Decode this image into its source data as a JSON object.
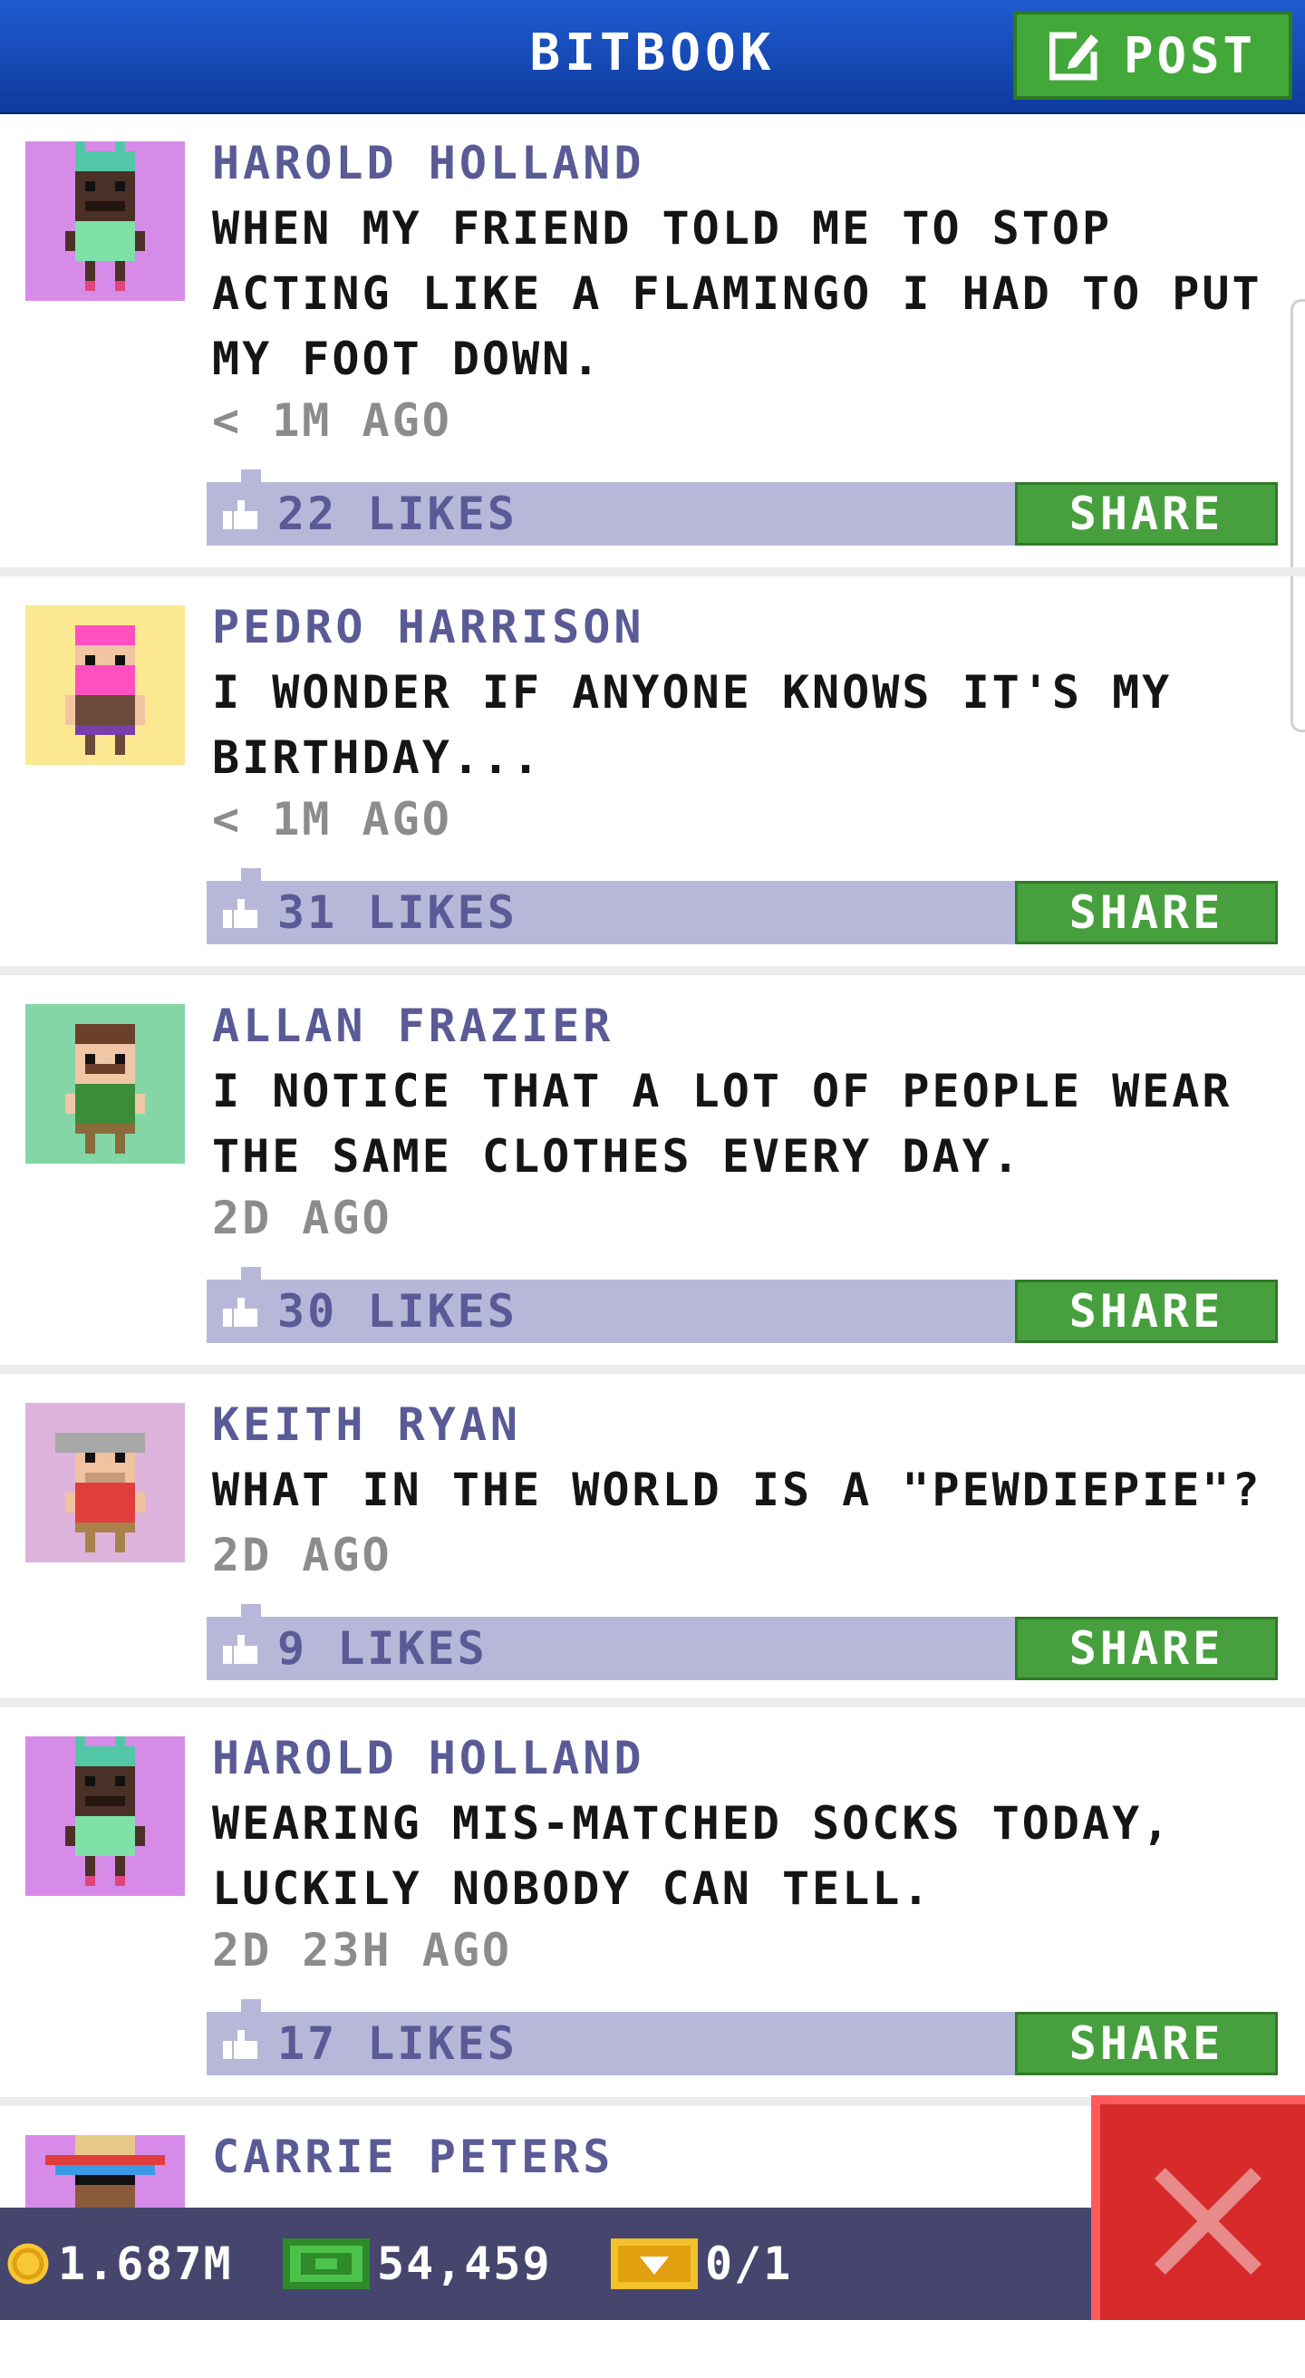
{
  "app": {
    "title": "BITBOOK",
    "post_label": "POST"
  },
  "posts": [
    {
      "author": "HAROLD HOLLAND",
      "text": "WHEN MY FRIEND TOLD ME TO STOP ACTING LIKE A FLAMINGO I HAD TO PUT MY FOOT DOWN.",
      "time": "< 1M AGO",
      "likes": "22 LIKES",
      "share": "SHARE",
      "avatar_bg": "#d78be8"
    },
    {
      "author": "PEDRO HARRISON",
      "text": "I WONDER IF ANYONE KNOWS IT'S MY BIRTHDAY...",
      "time": "< 1M AGO",
      "likes": "31 LIKES",
      "share": "SHARE",
      "avatar_bg": "#fbe891"
    },
    {
      "author": "ALLAN FRAZIER",
      "text": "I NOTICE THAT A LOT OF PEOPLE WEAR THE SAME CLOTHES EVERY DAY.",
      "time": "2D AGO",
      "likes": "30 LIKES",
      "share": "SHARE",
      "avatar_bg": "#84d6a6"
    },
    {
      "author": "KEITH RYAN",
      "text": "WHAT IN THE WORLD IS A \"PEWDIEPIE\"?",
      "time": "2D AGO",
      "likes": "9 LIKES",
      "share": "SHARE",
      "avatar_bg": "#ddb3db"
    },
    {
      "author": "HAROLD HOLLAND",
      "text": "WEARING MIS-MATCHED SOCKS TODAY, LUCKILY NOBODY CAN TELL.",
      "time": "2D 23H AGO",
      "likes": "17 LIKES",
      "share": "SHARE",
      "avatar_bg": "#d78be8"
    },
    {
      "author": "CARRIE PETERS",
      "avatar_bg": "#d78be8"
    }
  ],
  "status": {
    "coins": "1.687M",
    "bux": "54,459",
    "tickets": "0/1"
  },
  "colors": {
    "header": "#1f5bd1",
    "post_button": "#43a83a",
    "likes_bar": "#b7b8d9",
    "close": "#d72a2a",
    "statusbar": "#45456d"
  }
}
